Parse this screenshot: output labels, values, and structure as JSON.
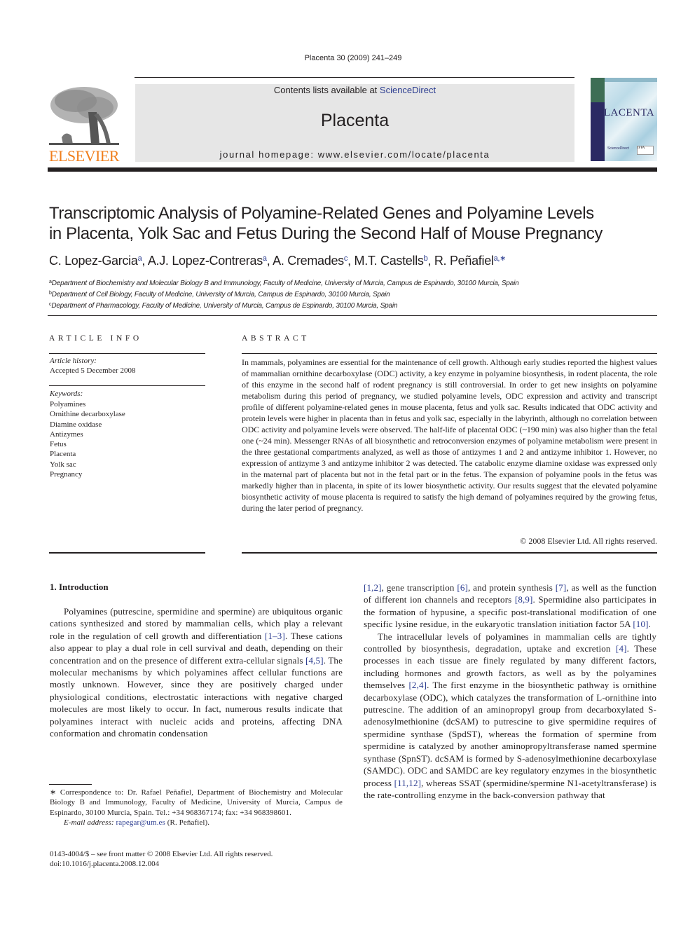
{
  "header": {
    "citation": "Placenta 30 (2009) 241–249",
    "contents_prefix": "Contents lists available at ",
    "contents_link": "ScienceDirect",
    "journal_name": "Placenta",
    "homepage": "journal homepage: www.elsevier.com/locate/placenta",
    "publisher_logo_text": "ELSEVIER",
    "cover_title": "PLACENTA",
    "cover_pub1": "ScienceDirect",
    "cover_pub2": "IFPA"
  },
  "colors": {
    "publisher_orange": "#f07e1b",
    "link_blue": "#2a3b8f",
    "masthead_gray": "#e6e6e6",
    "cover_navy": "#2b2a63"
  },
  "article": {
    "title_line1": "Transcriptomic Analysis of Polyamine-Related Genes and Polyamine Levels",
    "title_line2": "in Placenta, Yolk Sac and Fetus During the Second Half of Mouse Pregnancy",
    "authors": [
      {
        "name": "C. Lopez-Garcia",
        "aff": "a"
      },
      {
        "name": "A.J. Lopez-Contreras",
        "aff": "a"
      },
      {
        "name": "A. Cremades",
        "aff": "c"
      },
      {
        "name": "M.T. Castells",
        "aff": "b"
      },
      {
        "name": "R. Peñafiel",
        "aff": "a,∗"
      }
    ],
    "affiliations": [
      {
        "key": "a",
        "text": "Department of Biochemistry and Molecular Biology B and Immunology, Faculty of Medicine, University of Murcia, Campus de Espinardo, 30100 Murcia, Spain"
      },
      {
        "key": "b",
        "text": "Department of Cell Biology, Faculty of Medicine, University of Murcia, Campus de Espinardo, 30100 Murcia, Spain"
      },
      {
        "key": "c",
        "text": "Department of Pharmacology, Faculty of Medicine, University of Murcia, Campus de Espinardo, 30100 Murcia, Spain"
      }
    ]
  },
  "article_info": {
    "heading": "ARTICLE INFO",
    "history_label": "Article history:",
    "history_value": "Accepted 5 December 2008",
    "keywords_label": "Keywords:",
    "keywords": [
      "Polyamines",
      "Ornithine decarboxylase",
      "Diamine oxidase",
      "Antizymes",
      "Fetus",
      "Placenta",
      "Yolk sac",
      "Pregnancy"
    ]
  },
  "abstract": {
    "heading": "ABSTRACT",
    "text": "In mammals, polyamines are essential for the maintenance of cell growth. Although early studies reported the highest values of mammalian ornithine decarboxylase (ODC) activity, a key enzyme in polyamine biosynthesis, in rodent placenta, the role of this enzyme in the second half of rodent pregnancy is still controversial. In order to get new insights on polyamine metabolism during this period of pregnancy, we studied polyamine levels, ODC expression and activity and transcript profile of different polyamine-related genes in mouse placenta, fetus and yolk sac. Results indicated that ODC activity and protein levels were higher in placenta than in fetus and yolk sac, especially in the labyrinth, although no correlation between ODC activity and polyamine levels were observed. The half-life of placental ODC (~190 min) was also higher than the fetal one (~24 min). Messenger RNAs of all biosynthetic and retroconversion enzymes of polyamine metabolism were present in the three gestational compartments analyzed, as well as those of antizymes 1 and 2 and antizyme inhibitor 1. However, no expression of antizyme 3 and antizyme inhibitor 2 was detected. The catabolic enzyme diamine oxidase was expressed only in the maternal part of placenta but not in the fetal part or in the fetus. The expansion of polyamine pools in the fetus was markedly higher than in placenta, in spite of its lower biosynthetic activity. Our results suggest that the elevated polyamine biosynthetic activity of mouse placenta is required to satisfy the high demand of polyamines required by the growing fetus, during the later period of pregnancy.",
    "copyright": "© 2008 Elsevier Ltd. All rights reserved."
  },
  "body": {
    "intro_heading": "1.  Introduction",
    "left_col": {
      "p1_a": "Polyamines (putrescine, spermidine and spermine) are ubiquitous organic cations synthesized and stored by mammalian cells, which play a relevant role in the regulation of cell growth and differentiation ",
      "ref1": "[1–3]",
      "p1_b": ". These cations also appear to play a dual role in cell survival and death, depending on their concentration and on the presence of different extra-cellular signals ",
      "ref2": "[4,5]",
      "p1_c": ". The molecular mechanisms by which polyamines affect cellular functions are mostly unknown. However, since they are positively charged under physiological conditions, electrostatic interactions with negative charged molecules are most likely to occur. In fact, numerous results indicate that polyamines interact with nucleic acids and proteins, affecting DNA conformation and chromatin condensation"
    },
    "right_col": {
      "ref_a": "[1,2]",
      "t_a": ", gene transcription ",
      "ref_b": "[6]",
      "t_b": ", and protein synthesis ",
      "ref_c": "[7]",
      "t_c": ", as well as the function of different ion channels and receptors ",
      "ref_d": "[8,9]",
      "t_d": ". Spermidine also participates in the formation of hypusine, a specific post-translational modification of one specific lysine residue, in the eukaryotic translation initiation factor 5A ",
      "ref_e": "[10]",
      "t_e": ".",
      "p2_a": "The intracellular levels of polyamines in mammalian cells are tightly controlled by biosynthesis, degradation, uptake and excretion ",
      "ref_f": "[4]",
      "p2_b": ". These processes in each tissue are finely regulated by many different factors, including hormones and growth factors, as well as by the polyamines themselves ",
      "ref_g": "[2,4]",
      "p2_c": ". The first enzyme in the biosynthetic pathway is ornithine decarboxylase (ODC), which catalyzes the transformation of L-ornithine into putrescine. The addition of an aminopropyl group from decarboxylated S-adenosylmethionine (dcSAM) to putrescine to give spermidine requires of spermidine synthase (SpdST), whereas the formation of spermine from spermidine is catalyzed by another aminopropyltransferase named spermine synthase (SpnST). dcSAM is formed by S-adenosylmethionine decarboxylase (SAMDC). ODC and SAMDC are key regulatory enzymes in the biosynthetic process ",
      "ref_h": "[11,12]",
      "p2_d": ", whereas SSAT (spermidine/spermine N1-acetyltransferase) is the rate-controlling enzyme in the back-conversion pathway that"
    }
  },
  "footnote": {
    "correspondence": "∗ Correspondence to: Dr. Rafael Peñafiel, Department of Biochemistry and Molecular Biology B and Immunology, Faculty of Medicine, University of Murcia, Campus de Espinardo, 30100 Murcia, Spain. Tel.: +34 968367174; fax: +34 968398601.",
    "email_label": "E-mail address: ",
    "email": "rapegar@um.es",
    "email_suffix": " (R. Peñafiel).",
    "front_matter": "0143-4004/$ – see front matter © 2008 Elsevier Ltd. All rights reserved.",
    "doi": "doi:10.1016/j.placenta.2008.12.004"
  }
}
